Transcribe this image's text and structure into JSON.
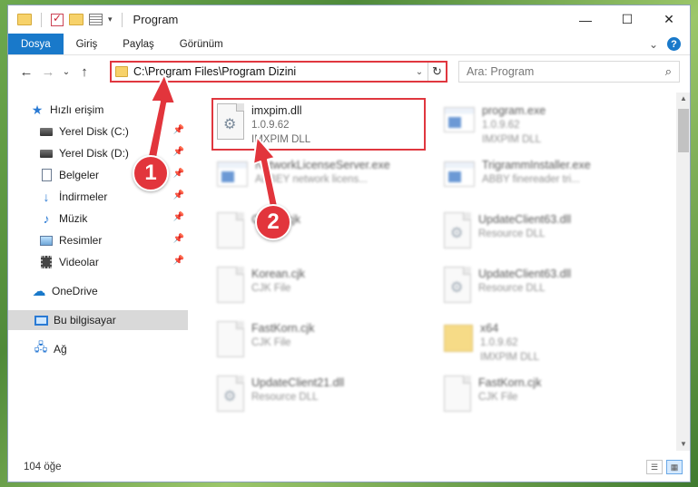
{
  "window": {
    "title": "Program",
    "buttons": {
      "minimize": "—",
      "maximize": "☐",
      "close": "✕"
    }
  },
  "ribbon": {
    "tabs": [
      "Dosya",
      "Giriş",
      "Paylaş",
      "Görünüm"
    ],
    "expand_glyph": "⌄",
    "help_glyph": "?"
  },
  "address": {
    "path": "C:\\Program Files\\Program Dizini",
    "dropdown_glyph": "⌄",
    "refresh_glyph": "↻"
  },
  "search": {
    "placeholder": "Ara: Program",
    "icon_glyph": "⌕"
  },
  "nav_buttons": {
    "back": "←",
    "forward": "→",
    "recent": "⌄",
    "up": "↑"
  },
  "sidebar": {
    "items": [
      {
        "label": "Hızlı erişim",
        "icon": "star-icon",
        "pinned": false
      },
      {
        "label": "Yerel Disk (C:)",
        "icon": "drive-icon",
        "pinned": true
      },
      {
        "label": "Yerel Disk (D:)",
        "icon": "drive-icon",
        "pinned": true
      },
      {
        "label": "Belgeler",
        "icon": "document-icon",
        "pinned": true
      },
      {
        "label": "İndirmeler",
        "icon": "download-icon",
        "pinned": true
      },
      {
        "label": "Müzik",
        "icon": "music-icon",
        "pinned": true
      },
      {
        "label": "Resimler",
        "icon": "pictures-icon",
        "pinned": true
      },
      {
        "label": "Videolar",
        "icon": "videos-icon",
        "pinned": true
      },
      {
        "label": "OneDrive",
        "icon": "cloud-icon",
        "pinned": false
      },
      {
        "label": "Bu bilgisayar",
        "icon": "computer-icon",
        "pinned": false,
        "selected": true
      },
      {
        "label": "Ağ",
        "icon": "network-icon",
        "pinned": false
      }
    ],
    "pin_glyph": "📌"
  },
  "files": [
    {
      "name": "imxpim.dll",
      "line2": "1.0.9.62",
      "line3": "IMXPIM DLL",
      "icon": "dll-icon",
      "highlighted": true
    },
    {
      "name": "program.exe",
      "line2": "1.0.9.62",
      "line3": "IMXPIM DLL",
      "icon": "exe-icon"
    },
    {
      "name": "NetworkLicenseServer.exe",
      "line2": "ABBEY network licens...",
      "line3": "",
      "icon": "exe-icon"
    },
    {
      "name": "TrigrammInstaller.exe",
      "line2": "ABBY finereader tri...",
      "line3": "",
      "icon": "exe-icon"
    },
    {
      "name": "Czech.cjk",
      "line2": "",
      "line3": "",
      "icon": "file-icon"
    },
    {
      "name": "UpdateClient63.dll",
      "line2": "Resource DLL",
      "line3": "",
      "icon": "dll-icon"
    },
    {
      "name": "Korean.cjk",
      "line2": "CJK File",
      "line3": "",
      "icon": "file-icon"
    },
    {
      "name": "UpdateClient63.dll",
      "line2": "Resource DLL",
      "line3": "",
      "icon": "dll-icon"
    },
    {
      "name": "FastKorn.cjk",
      "line2": "CJK File",
      "line3": "",
      "icon": "file-icon"
    },
    {
      "name": "x64",
      "line2": "1.0.9.62",
      "line3": "IMXPIM DLL",
      "icon": "folder-icon"
    },
    {
      "name": "UpdateClient21.dll",
      "line2": "Resource DLL",
      "line3": "",
      "icon": "dll-icon"
    },
    {
      "name": "FastKorn.cjk",
      "line2": "CJK File",
      "line3": "",
      "icon": "file-icon"
    }
  ],
  "status": {
    "count": "104 öğe"
  },
  "callouts": {
    "one": "1",
    "two": "2"
  },
  "colors": {
    "accent": "#1979ca",
    "callout_red": "#e2353c"
  }
}
